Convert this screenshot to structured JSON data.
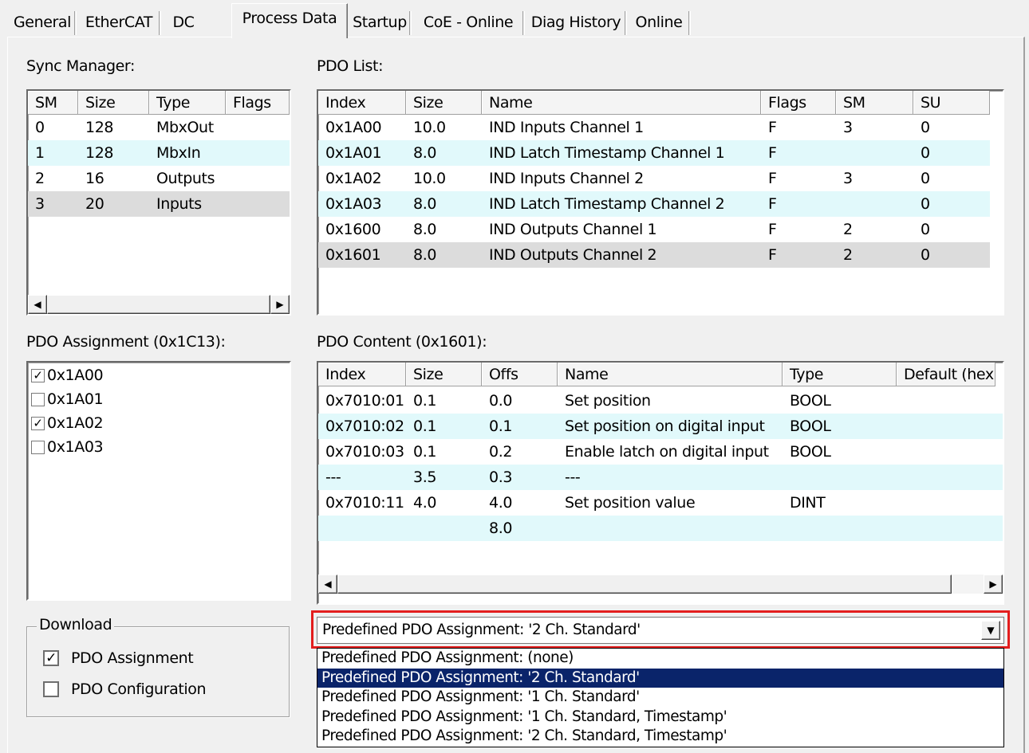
{
  "tabs": [
    {
      "label": "General"
    },
    {
      "label": "EtherCAT"
    },
    {
      "label": "DC"
    },
    {
      "label": "Process Data"
    },
    {
      "label": "Startup"
    },
    {
      "label": "CoE - Online"
    },
    {
      "label": "Diag History"
    },
    {
      "label": "Online"
    }
  ],
  "active_tab": "Process Data",
  "sync_manager": {
    "label": "Sync Manager:",
    "columns": [
      "SM",
      "Size",
      "Type",
      "Flags"
    ],
    "rows": [
      {
        "sm": "0",
        "size": "128",
        "type": "MbxOut",
        "flags": ""
      },
      {
        "sm": "1",
        "size": "128",
        "type": "MbxIn",
        "flags": ""
      },
      {
        "sm": "2",
        "size": "16",
        "type": "Outputs",
        "flags": ""
      },
      {
        "sm": "3",
        "size": "20",
        "type": "Inputs",
        "flags": ""
      }
    ]
  },
  "pdo_list": {
    "label": "PDO List:",
    "columns": [
      "Index",
      "Size",
      "Name",
      "Flags",
      "SM",
      "SU"
    ],
    "rows": [
      {
        "index": "0x1A00",
        "size": "10.0",
        "name": "IND Inputs Channel 1",
        "flags": "F",
        "sm": "3",
        "su": "0"
      },
      {
        "index": "0x1A01",
        "size": "8.0",
        "name": "IND Latch Timestamp Channel 1",
        "flags": "F",
        "sm": "",
        "su": "0"
      },
      {
        "index": "0x1A02",
        "size": "10.0",
        "name": "IND Inputs Channel 2",
        "flags": "F",
        "sm": "3",
        "su": "0"
      },
      {
        "index": "0x1A03",
        "size": "8.0",
        "name": "IND Latch Timestamp Channel 2",
        "flags": "F",
        "sm": "",
        "su": "0"
      },
      {
        "index": "0x1600",
        "size": "8.0",
        "name": "IND Outputs Channel 1",
        "flags": "F",
        "sm": "2",
        "su": "0"
      },
      {
        "index": "0x1601",
        "size": "8.0",
        "name": "IND Outputs Channel 2",
        "flags": "F",
        "sm": "2",
        "su": "0"
      }
    ]
  },
  "pdo_assignment": {
    "label": "PDO Assignment (0x1C13):",
    "items": [
      {
        "label": "0x1A00",
        "checked": true
      },
      {
        "label": "0x1A01",
        "checked": false
      },
      {
        "label": "0x1A02",
        "checked": true
      },
      {
        "label": "0x1A03",
        "checked": false
      }
    ]
  },
  "pdo_content": {
    "label": "PDO Content (0x1601):",
    "columns": [
      "Index",
      "Size",
      "Offs",
      "Name",
      "Type",
      "Default (hex"
    ],
    "rows": [
      {
        "index": "0x7010:01",
        "size": "0.1",
        "offs": "0.0",
        "name": "Set position",
        "type": "BOOL",
        "default": ""
      },
      {
        "index": "0x7010:02",
        "size": "0.1",
        "offs": "0.1",
        "name": "Set position on digital input",
        "type": "BOOL",
        "default": ""
      },
      {
        "index": "0x7010:03",
        "size": "0.1",
        "offs": "0.2",
        "name": "Enable latch on digital input",
        "type": "BOOL",
        "default": ""
      },
      {
        "index": "---",
        "size": "3.5",
        "offs": "0.3",
        "name": "---",
        "type": "",
        "default": ""
      },
      {
        "index": "0x7010:11",
        "size": "4.0",
        "offs": "4.0",
        "name": "Set position value",
        "type": "DINT",
        "default": ""
      },
      {
        "index": "",
        "size": "",
        "offs": "8.0",
        "name": "",
        "type": "",
        "default": ""
      }
    ]
  },
  "download": {
    "title": "Download",
    "options": [
      {
        "label": "PDO Assignment",
        "checked": true
      },
      {
        "label": "PDO Configuration",
        "checked": false
      }
    ]
  },
  "predefined": {
    "selected": "Predefined PDO Assignment: '2 Ch. Standard'",
    "options": [
      "Predefined PDO Assignment: (none)",
      "Predefined PDO Assignment: '2 Ch. Standard'",
      "Predefined PDO Assignment: '1 Ch. Standard'",
      "Predefined PDO Assignment: '1 Ch. Standard, Timestamp'",
      "Predefined PDO Assignment: '2 Ch. Standard, Timestamp'"
    ],
    "highlighted_index": 1
  },
  "colors": {
    "window_bg": "#f0f0f0",
    "row_alt": "#e1f9fb",
    "row_selected": "#dcdcdc",
    "highlight_frame": "#e31d1d",
    "dropdown_selection": "#0a246a"
  }
}
